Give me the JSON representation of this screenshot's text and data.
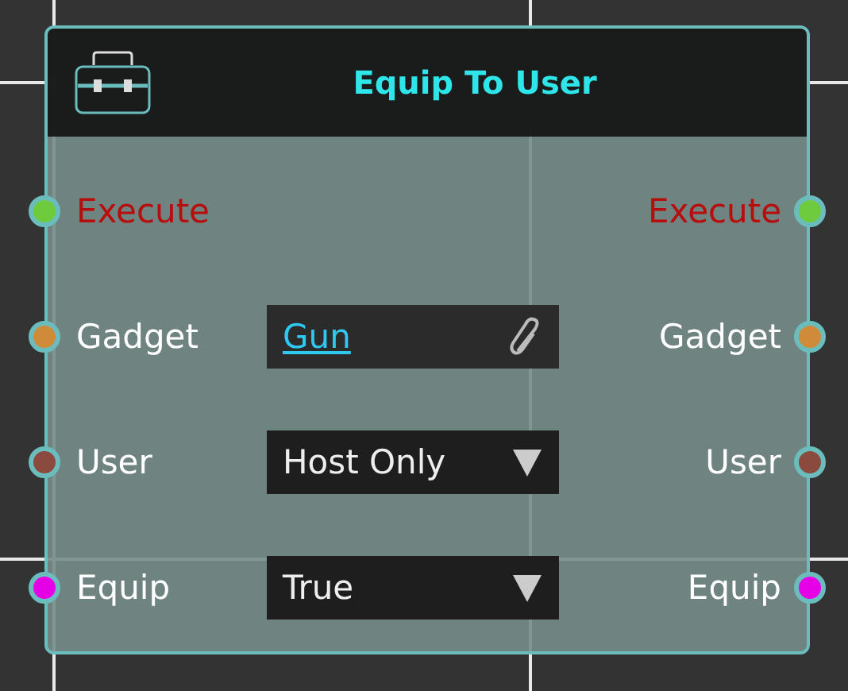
{
  "node": {
    "title": "Equip To User",
    "rows": [
      {
        "kind": "exec",
        "input": {
          "label": "Execute",
          "color": "#6fcb3e"
        },
        "output": {
          "label": "Execute",
          "color": "#6fcb3e"
        }
      },
      {
        "kind": "data",
        "input": {
          "label": "Gadget",
          "color": "#d08b3a"
        },
        "field": {
          "kind": "link",
          "value": "Gun"
        },
        "output": {
          "label": "Gadget",
          "color": "#d08b3a"
        }
      },
      {
        "kind": "data",
        "input": {
          "label": "User",
          "color": "#8a4a3e"
        },
        "field": {
          "kind": "dropdown",
          "value": "Host Only"
        },
        "output": {
          "label": "User",
          "color": "#8a4a3e"
        }
      },
      {
        "kind": "data",
        "input": {
          "label": "Equip",
          "color": "#e600e6"
        },
        "field": {
          "kind": "dropdown",
          "value": "True"
        },
        "output": {
          "label": "Equip",
          "color": "#e600e6"
        }
      }
    ]
  }
}
